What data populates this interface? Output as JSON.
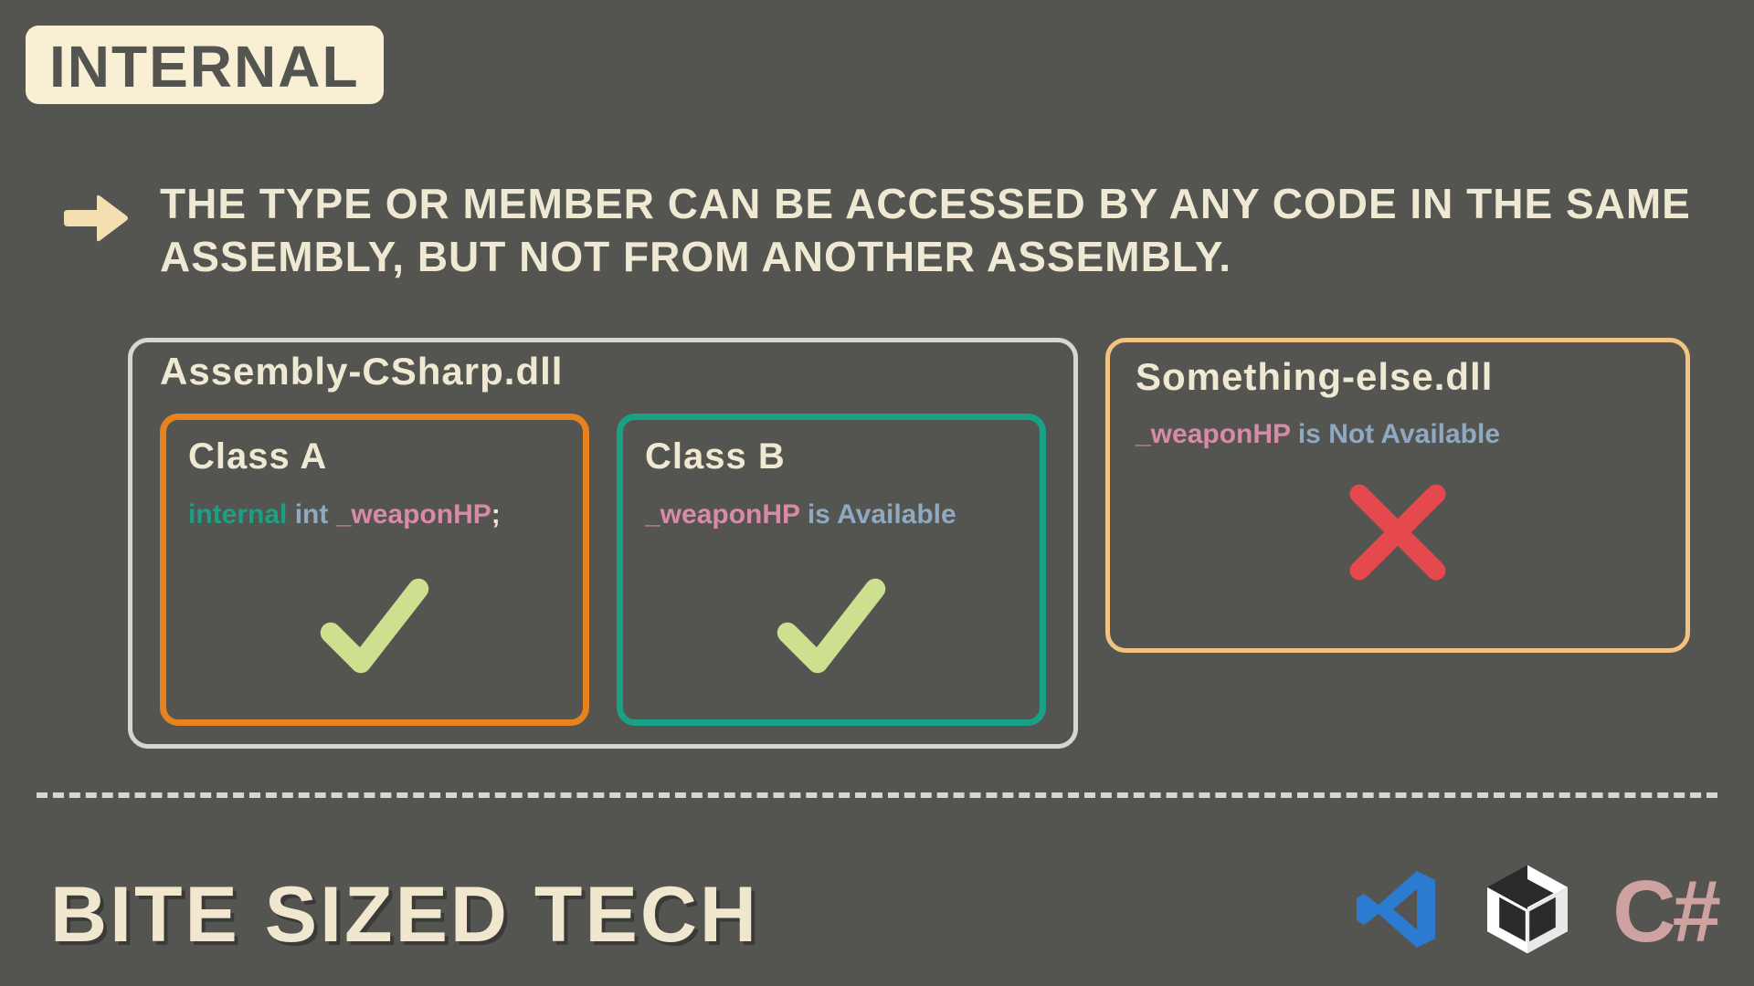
{
  "badge": "INTERNAL",
  "description": "The type or member can be accessed by any code in the same assembly, but not from another assembly.",
  "assembly_main": {
    "label": "Assembly-CSharp.dll",
    "class_a": {
      "title": "Class A",
      "kw1": "internal",
      "kw2": "int",
      "var": "_weaponHP",
      "semi": ";"
    },
    "class_b": {
      "title": "Class B",
      "var": "_weaponHP",
      "status": " is Available"
    }
  },
  "assembly_other": {
    "label": "Something-else.dll",
    "var": "_weaponHP",
    "status": " is Not Available"
  },
  "brand": "BITE SIZED TECH",
  "csharp": "C#",
  "colors": {
    "check": "#cde08f",
    "cross": "#e5484d",
    "vscode": "#2b7bd1",
    "unity_dark": "#2b2b2b",
    "unity_light": "#ffffff"
  }
}
